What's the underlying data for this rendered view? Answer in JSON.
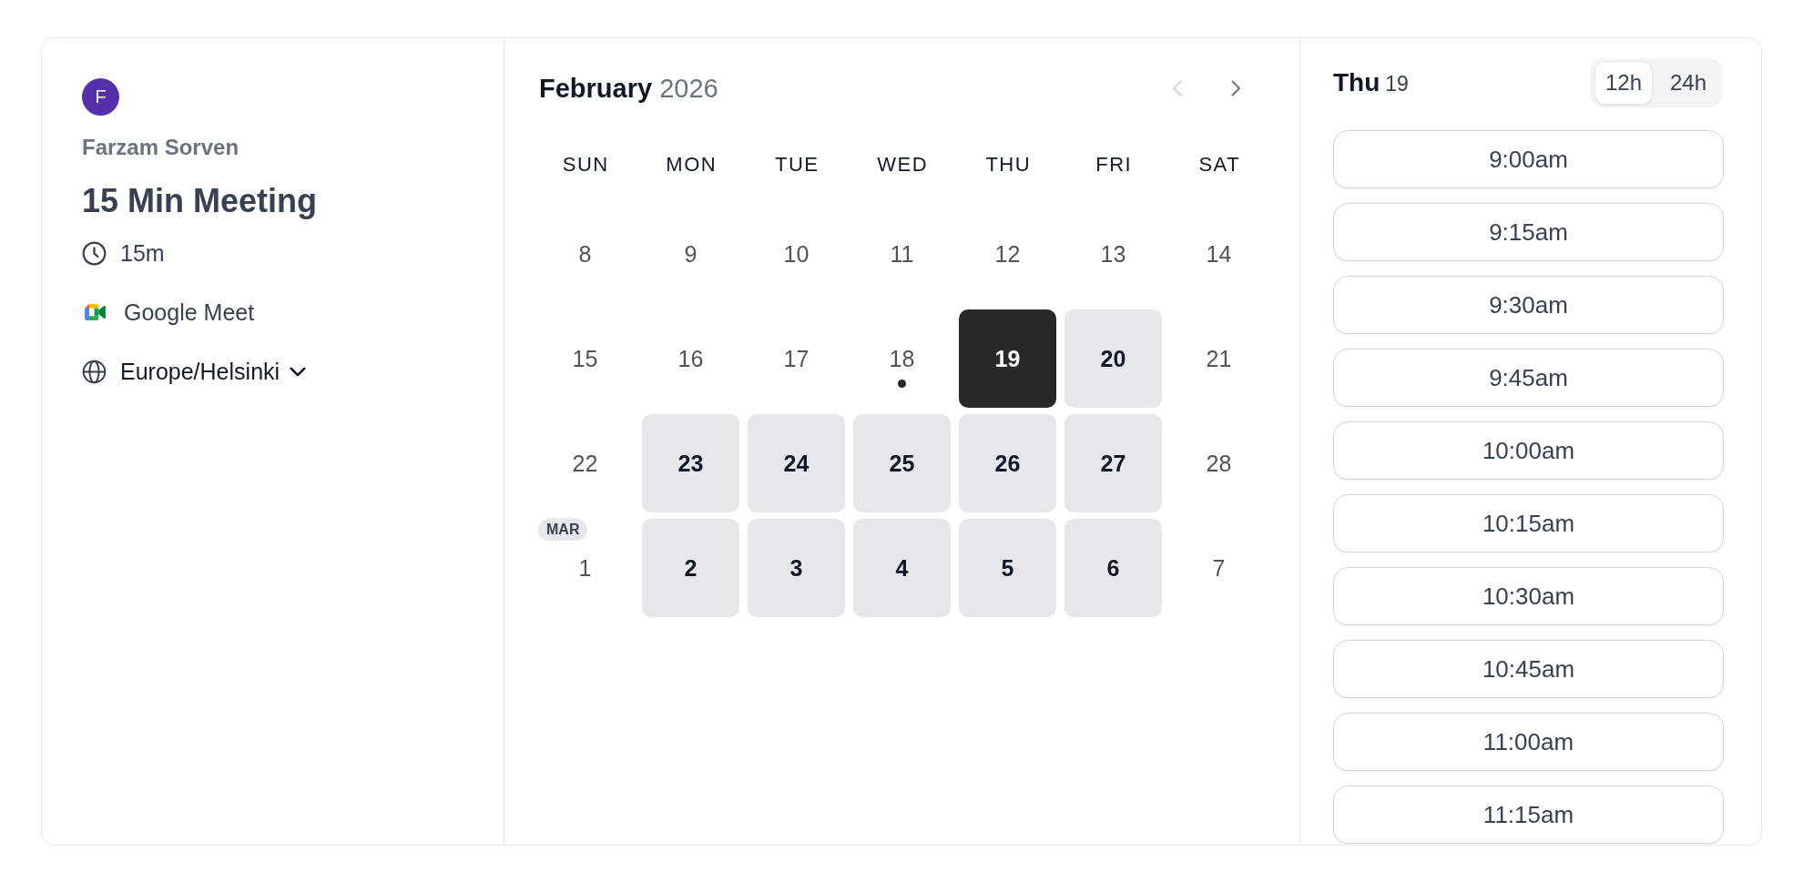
{
  "host": {
    "initial": "F",
    "name": "Farzam Sorven"
  },
  "event": {
    "title": "15 Min Meeting",
    "details": [
      {
        "kind": "duration",
        "text": "15m"
      },
      {
        "kind": "video",
        "text": "Google Meet"
      },
      {
        "kind": "timezone",
        "text": "Europe/Helsinki"
      }
    ]
  },
  "calendar": {
    "month": "February",
    "year": "2026",
    "previous_disabled": true,
    "next_disabled": false,
    "weekdays": [
      "SUN",
      "MON",
      "TUE",
      "WED",
      "THU",
      "FRI",
      "SAT"
    ],
    "weeks": [
      {
        "days": [
          {
            "day": "8",
            "available": false,
            "selected": false,
            "today": false
          },
          {
            "day": "9",
            "available": false,
            "selected": false,
            "today": false
          },
          {
            "day": "10",
            "available": false,
            "selected": false,
            "today": false
          },
          {
            "day": "11",
            "available": false,
            "selected": false,
            "today": false
          },
          {
            "day": "12",
            "available": false,
            "selected": false,
            "today": false
          },
          {
            "day": "13",
            "available": false,
            "selected": false,
            "today": false
          },
          {
            "day": "14",
            "available": false,
            "selected": false,
            "today": false
          }
        ]
      },
      {
        "days": [
          {
            "day": "15",
            "available": false,
            "selected": false,
            "today": false
          },
          {
            "day": "16",
            "available": false,
            "selected": false,
            "today": false
          },
          {
            "day": "17",
            "available": false,
            "selected": false,
            "today": false
          },
          {
            "day": "18",
            "available": false,
            "selected": false,
            "today": true
          },
          {
            "day": "19",
            "available": true,
            "selected": true,
            "today": false
          },
          {
            "day": "20",
            "available": true,
            "selected": false,
            "today": false
          },
          {
            "day": "21",
            "available": false,
            "selected": false,
            "today": false
          }
        ]
      },
      {
        "days": [
          {
            "day": "22",
            "available": false,
            "selected": false,
            "today": false
          },
          {
            "day": "23",
            "available": true,
            "selected": false,
            "today": false
          },
          {
            "day": "24",
            "available": true,
            "selected": false,
            "today": false
          },
          {
            "day": "25",
            "available": true,
            "selected": false,
            "today": false
          },
          {
            "day": "26",
            "available": true,
            "selected": false,
            "today": false
          },
          {
            "day": "27",
            "available": true,
            "selected": false,
            "today": false
          },
          {
            "day": "28",
            "available": false,
            "selected": false,
            "today": false
          }
        ]
      },
      {
        "days": [
          {
            "day": "1",
            "month_badge": "MAR",
            "available": false,
            "selected": false,
            "today": false
          },
          {
            "day": "2",
            "available": true,
            "selected": false,
            "today": false
          },
          {
            "day": "3",
            "available": true,
            "selected": false,
            "today": false
          },
          {
            "day": "4",
            "available": true,
            "selected": false,
            "today": false
          },
          {
            "day": "5",
            "available": true,
            "selected": false,
            "today": false
          },
          {
            "day": "6",
            "available": true,
            "selected": false,
            "today": false
          },
          {
            "day": "7",
            "available": false,
            "selected": false,
            "today": false
          }
        ]
      }
    ]
  },
  "times": {
    "weekday": "Thu",
    "day": "19",
    "formats": [
      {
        "label": "12h",
        "selected": true
      },
      {
        "label": "24h",
        "selected": false
      }
    ],
    "slots": [
      "9:00am",
      "9:15am",
      "9:30am",
      "9:45am",
      "10:00am",
      "10:15am",
      "10:30am",
      "10:45am",
      "11:00am",
      "11:15am"
    ]
  }
}
